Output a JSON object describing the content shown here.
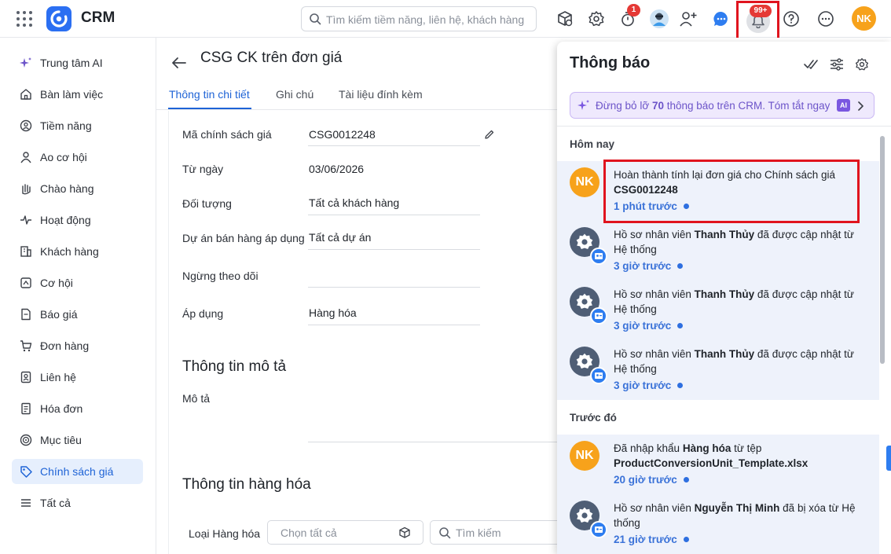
{
  "app": {
    "name": "CRM"
  },
  "search": {
    "placeholder": "Tìm kiếm tiềm năng, liên hệ, khách hàng"
  },
  "topbar": {
    "timer_badge": "1",
    "bell_badge": "99+",
    "avatar_initials": "NK"
  },
  "sidebar": {
    "items": [
      {
        "label": "Trung tâm AI",
        "icon": "sparkle-icon"
      },
      {
        "label": "Bàn làm việc",
        "icon": "home-icon"
      },
      {
        "label": "Tiềm năng",
        "icon": "lead-icon"
      },
      {
        "label": "Ao cơ hội",
        "icon": "pool-icon"
      },
      {
        "label": "Chào hàng",
        "icon": "hand-icon"
      },
      {
        "label": "Hoạt động",
        "icon": "activity-icon"
      },
      {
        "label": "Khách hàng",
        "icon": "building-icon"
      },
      {
        "label": "Cơ hội",
        "icon": "opportunity-icon"
      },
      {
        "label": "Báo giá",
        "icon": "quote-icon"
      },
      {
        "label": "Đơn hàng",
        "icon": "cart-icon"
      },
      {
        "label": "Liên hệ",
        "icon": "contact-icon"
      },
      {
        "label": "Hóa đơn",
        "icon": "invoice-icon"
      },
      {
        "label": "Mục tiêu",
        "icon": "target-icon"
      },
      {
        "label": "Chính sách giá",
        "icon": "price-tag-icon",
        "active": true
      },
      {
        "label": "Tất cả",
        "icon": "menu-icon"
      }
    ]
  },
  "page": {
    "title": "CSG CK trên đơn giá",
    "tabs": [
      "Thông tin chi tiết",
      "Ghi chú",
      "Tài liệu đính kèm"
    ],
    "fields": [
      {
        "label": "Mã chính sách giá",
        "value": "CSG0012248"
      },
      {
        "label": "Từ ngày",
        "value": "03/06/2026"
      },
      {
        "label": "Đối tượng",
        "value": "Tất cả khách hàng"
      },
      {
        "label": "Dự án bán hàng áp dụng",
        "value": "Tất cả dự án"
      },
      {
        "label": "Ngừng theo dõi",
        "value": ""
      },
      {
        "label": "Áp dụng",
        "value": "Hàng hóa"
      }
    ],
    "section_description": "Thông tin mô tả",
    "description_label": "Mô tả",
    "section_goods": "Thông tin hàng hóa",
    "goods_type_label": "Loại Hàng hóa",
    "goods_type_placeholder": "Chọn tất cả",
    "goods_search_placeholder": "Tìm kiếm"
  },
  "notifications": {
    "title": "Thông báo",
    "ai_banner": {
      "prefix": "Đừng bỏ lỡ ",
      "count": "70",
      "suffix": " thông báo trên CRM. Tóm tắt ngay",
      "badge": "AI"
    },
    "today_label": "Hôm nay",
    "earlier_label": "Trước đó",
    "today": [
      {
        "avatar": "NK",
        "text_before": "Hoàn thành tính lại đơn giá cho Chính sách giá ",
        "bold": "CSG0012248",
        "text_after": "",
        "time": "1 phút trước"
      },
      {
        "avatar": "gear",
        "text_before": "Hồ sơ nhân viên ",
        "bold": "Thanh Thủy",
        "text_after": " đã được cập nhật từ Hệ thống",
        "time": "3 giờ trước"
      },
      {
        "avatar": "gear",
        "text_before": "Hồ sơ nhân viên ",
        "bold": "Thanh Thủy",
        "text_after": " đã được cập nhật từ Hệ thống",
        "time": "3 giờ trước"
      },
      {
        "avatar": "gear",
        "text_before": "Hồ sơ nhân viên ",
        "bold": "Thanh Thủy",
        "text_after": " đã được cập nhật từ Hệ thống",
        "time": "3 giờ trước"
      }
    ],
    "earlier": [
      {
        "avatar": "NK",
        "text_before": "Đã nhập khẩu ",
        "bold": "Hàng hóa",
        "text_after": " từ tệp ",
        "bold2": "ProductConversionUnit_Template.xlsx",
        "time": "20 giờ trước"
      },
      {
        "avatar": "gear",
        "text_before": "Hồ sơ nhân viên ",
        "bold": "Nguyễn Thị Minh",
        "text_after": " đã bị xóa từ Hệ thống",
        "time": "21 giờ trước"
      }
    ]
  },
  "colors": {
    "accent": "#1e63d6",
    "brand": "#2b6ff2",
    "avatar_orange": "#f7a21b",
    "highlight_red": "#e0141e",
    "ai_purple": "#7a57e0"
  }
}
